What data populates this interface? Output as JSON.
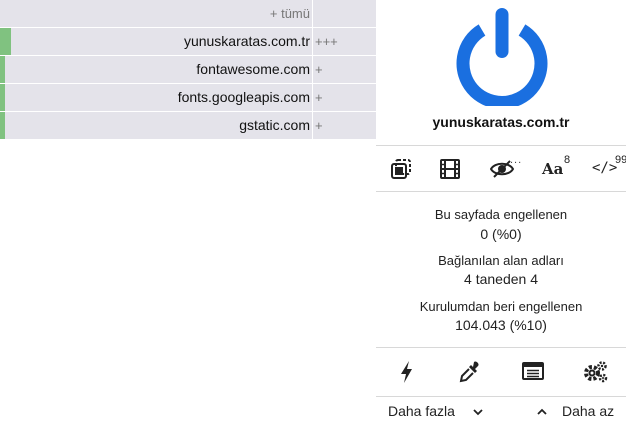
{
  "firewall": {
    "header": {
      "prefix": "+",
      "label": "tümü"
    },
    "rows": [
      {
        "domain": "yunuskaratas.com.tr",
        "marks": "+++",
        "allowed": 0.035
      },
      {
        "domain": "fontawesome.com",
        "marks": "+",
        "allowed": 0.015
      },
      {
        "domain": "fonts.googleapis.com",
        "marks": "+",
        "allowed": 0.015
      },
      {
        "domain": "gstatic.com",
        "marks": "+",
        "allowed": 0.015
      }
    ]
  },
  "panel": {
    "accent_color": "#1a6fe0",
    "hostname": "yunuskaratas.com.tr",
    "tools": [
      {
        "icon": "element-zapper-icon"
      },
      {
        "icon": "media-film-icon"
      },
      {
        "icon": "cosmetic-eye-icon",
        "badge": "..."
      },
      {
        "icon": "remote-fonts-icon",
        "text": "Aa",
        "badge": "8"
      },
      {
        "icon": "scripts-code-icon",
        "text": "</>",
        "badge": "99"
      }
    ],
    "stats": {
      "blocked_page_label": "Bu sayfada engellenen",
      "blocked_page_value": "0 (%0)",
      "domains_label": "Bağlanılan alan adları",
      "domains_value": "4 taneden 4",
      "blocked_total_label": "Kurulumdan beri engellenen",
      "blocked_total_value": "104.043 (%10)"
    },
    "bottom_tools": [
      {
        "icon": "lightning-icon"
      },
      {
        "icon": "eyedropper-icon"
      },
      {
        "icon": "logger-list-icon"
      },
      {
        "icon": "settings-gears-icon"
      }
    ],
    "more_label": "Daha fazla",
    "less_label": "Daha az"
  }
}
